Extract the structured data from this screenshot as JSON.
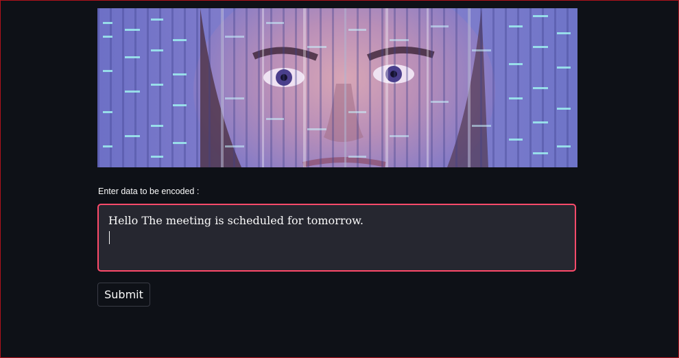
{
  "banner": {
    "image": "dna-sequencing-face-illustration"
  },
  "form": {
    "label": "Enter data to be encoded :",
    "textarea_value": "Hello The meeting is scheduled for tomorrow.",
    "submit_label": "Submit"
  },
  "colors": {
    "background": "#0e1117",
    "textarea_bg": "#262730",
    "focus_border": "#ff4b6b",
    "text": "#fafafa"
  }
}
